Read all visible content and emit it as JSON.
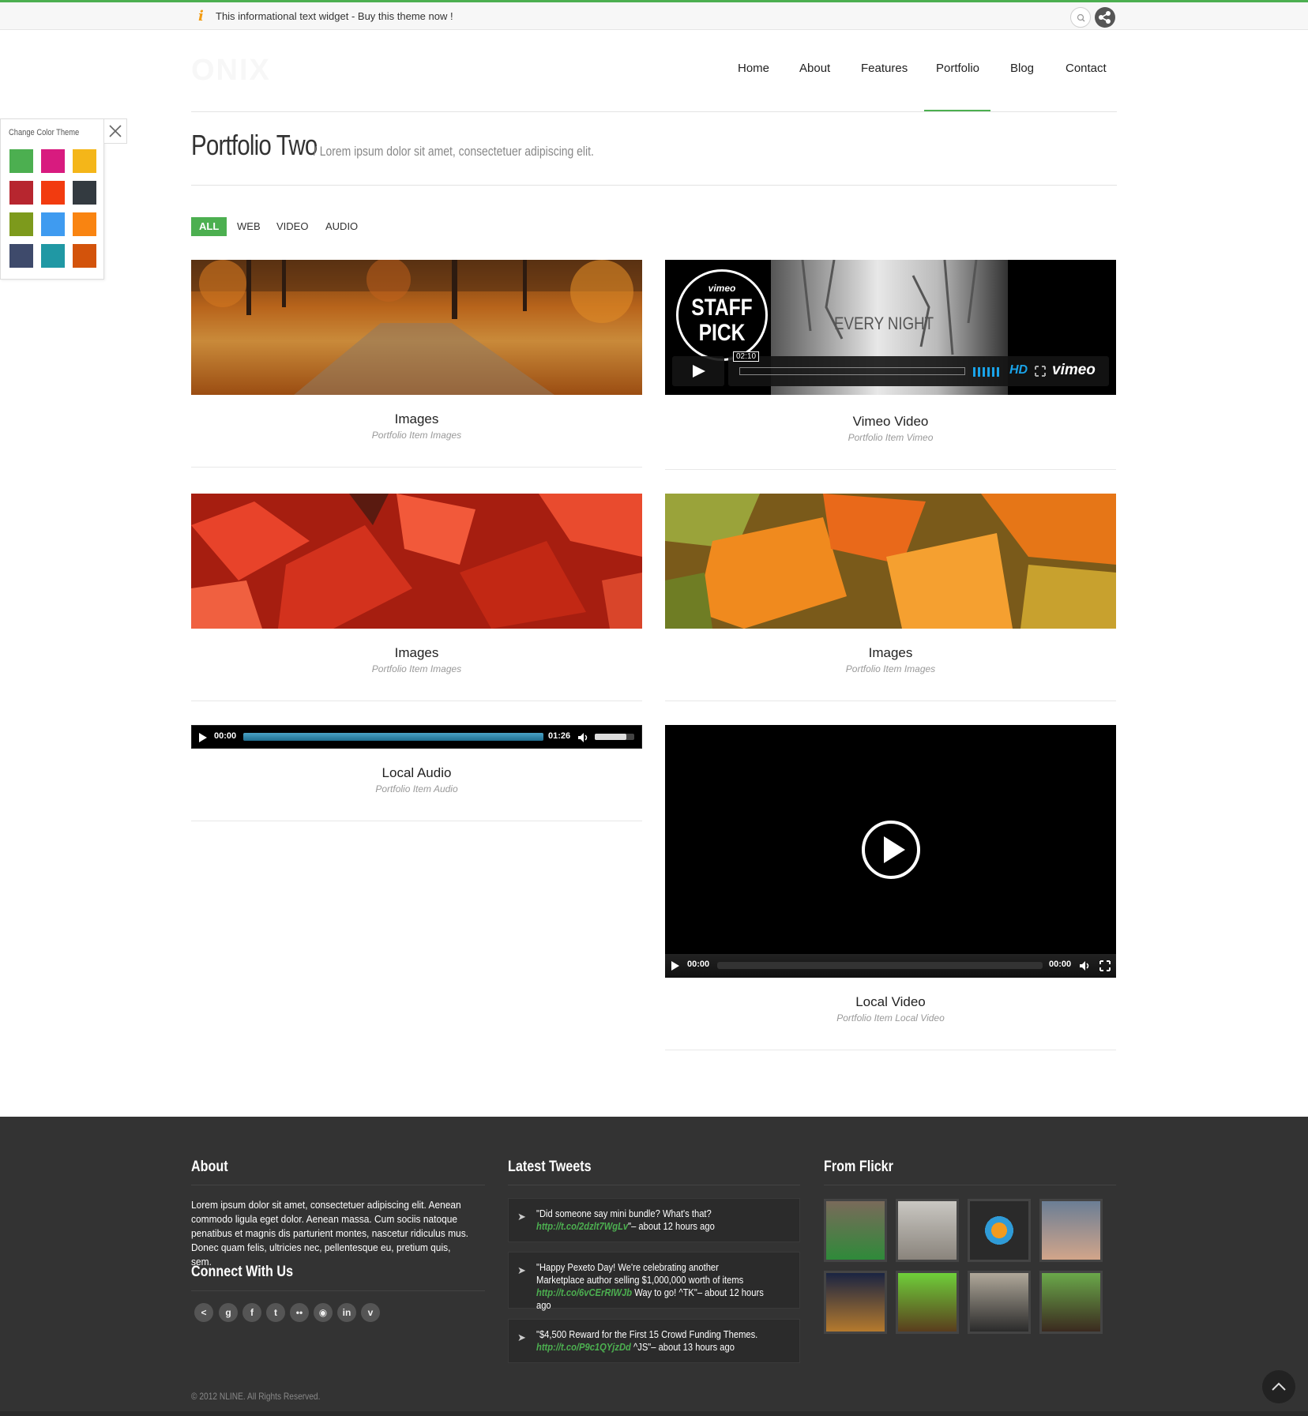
{
  "topbar": {
    "info_icon": "info-icon",
    "info_text": "This informational text widget - Buy this theme now !",
    "search_icon": "search-icon",
    "share_icon": "share-icon"
  },
  "brand": {
    "logo": "ONIX",
    "accent_color": "#4caf50"
  },
  "nav": {
    "items": [
      "Home",
      "About",
      "Features",
      "Portfolio",
      "Blog",
      "Contact"
    ],
    "active": "Portfolio"
  },
  "page": {
    "title": "Portfolio Two",
    "subtitle": "/ Lorem ipsum dolor sit amet, consectetuer adipiscing elit."
  },
  "filters": {
    "items": [
      "ALL",
      "WEB",
      "VIDEO",
      "AUDIO"
    ],
    "active": "ALL"
  },
  "theme_panel": {
    "title": "Change Color Theme",
    "close_icon": "close-icon",
    "swatches": [
      "#4caf50",
      "#d81b7f",
      "#f4b619",
      "#b7262f",
      "#f23b0f",
      "#333a40",
      "#7d9a1c",
      "#3f9bf0",
      "#f98411",
      "#3e4a6b",
      "#2098a4",
      "#d3530b"
    ]
  },
  "portfolio": [
    {
      "title": "Images",
      "category": "Portfolio Item Images",
      "media": "image"
    },
    {
      "title": "Vimeo Video",
      "category": "Portfolio Item Vimeo",
      "media": "vimeo"
    },
    {
      "title": "Images",
      "category": "Portfolio Item Images",
      "media": "image"
    },
    {
      "title": "Images",
      "category": "Portfolio Item Images",
      "media": "image"
    },
    {
      "title": "Local Audio",
      "category": "Portfolio Item Audio",
      "media": "audio"
    },
    {
      "title": "Local Video",
      "category": "Portfolio Item Local Video",
      "media": "video"
    }
  ],
  "vimeo": {
    "badge_brand": "vimeo",
    "badge_top": "STAFF",
    "badge_bottom": "PICK",
    "frame_text": "EVERY NIGHT",
    "duration": "02:10",
    "hd": "HD",
    "brand": "vimeo"
  },
  "audio_player": {
    "current": "00:00",
    "duration": "01:26",
    "progress": 1.0,
    "volume": 0.8
  },
  "video_player": {
    "current": "00:00",
    "duration": "00:00",
    "progress": 0.0
  },
  "footer": {
    "about_heading": "About",
    "about_text": "Lorem ipsum dolor sit amet, consectetuer adipiscing elit. Aenean commodo ligula eget dolor. Aenean massa. Cum sociis natoque penatibus et magnis dis parturient montes, nascetur ridiculus mus. Donec quam felis, ultricies nec, pellentesque eu, pretium quis, sem.",
    "connect_heading": "Connect With Us",
    "social_icons": [
      "share-icon",
      "google-icon",
      "facebook-icon",
      "twitter-icon",
      "flickr-icon",
      "dribbble-icon",
      "linkedin-icon",
      "vimeo-icon"
    ],
    "tweets_heading": "Latest Tweets",
    "tweets": [
      {
        "text": "\"Did someone say mini bundle? What's that?",
        "link": "http://t.co/2dzlt7WgLv",
        "time": "\"– about 12 hours ago"
      },
      {
        "text": "\"Happy Pexeto Day! We're celebrating another Marketplace author selling $1,000,000 worth of items",
        "link": "http://t.co/6vCErRIWJb",
        "time": " Way to go! ^TK\"– about 12 hours ago"
      },
      {
        "text": "\"$4,500 Reward for the First 15 Crowd Funding Themes.",
        "link": "http://t.co/P9c1QYjzDd",
        "time": " ^JS\"– about 13 hours ago"
      }
    ],
    "flickr_heading": "From Flickr",
    "copyright": "© 2012 NLINE. All Rights Reserved."
  }
}
